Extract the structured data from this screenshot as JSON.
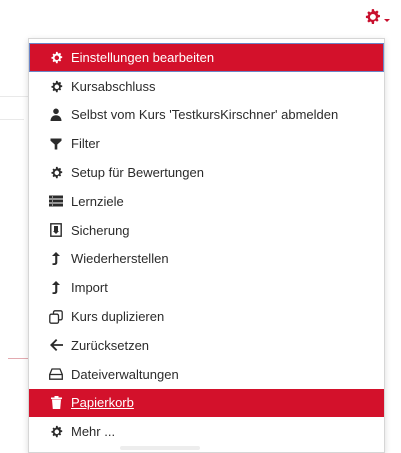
{
  "header": {
    "gear_icon": "gear-icon"
  },
  "menu": {
    "items": [
      {
        "label": "Einstellungen bearbeiten",
        "icon": "gear-icon"
      },
      {
        "label": "Kursabschluss",
        "icon": "gear-icon"
      },
      {
        "label": "Selbst vom Kurs 'TestkursKirschner' abmelden",
        "icon": "user-icon"
      },
      {
        "label": "Filter",
        "icon": "filter-icon"
      },
      {
        "label": "Setup für Bewertungen",
        "icon": "gear-icon"
      },
      {
        "label": "Lernziele",
        "icon": "list-icon"
      },
      {
        "label": "Sicherung",
        "icon": "file-icon"
      },
      {
        "label": "Wiederherstellen",
        "icon": "upload-arrow-icon"
      },
      {
        "label": "Import",
        "icon": "upload-arrow-icon"
      },
      {
        "label": "Kurs duplizieren",
        "icon": "copy-icon"
      },
      {
        "label": "Zurücksetzen",
        "icon": "arrow-left-icon"
      },
      {
        "label": "Dateiverwaltungen",
        "icon": "drive-icon"
      },
      {
        "label": "Papierkorb",
        "icon": "trash-icon"
      },
      {
        "label": "Mehr ...",
        "icon": "gear-icon"
      }
    ]
  },
  "colors": {
    "accent": "#d3112b",
    "text": "#2b2b2b",
    "focus_outline": "#6b86c8"
  }
}
